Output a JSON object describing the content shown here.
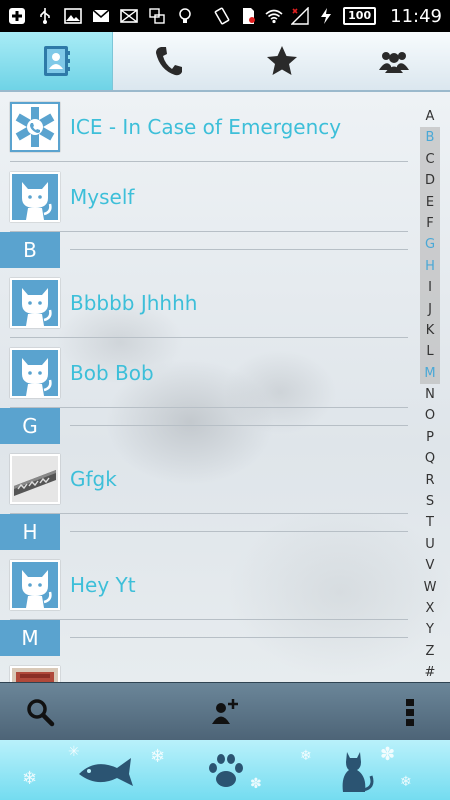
{
  "status_bar": {
    "battery": "100",
    "time": "11:49"
  },
  "tabs": [
    {
      "icon": "contacts-icon",
      "active": true
    },
    {
      "icon": "phone-icon",
      "active": false
    },
    {
      "icon": "star-icon",
      "active": false
    },
    {
      "icon": "groups-icon",
      "active": false
    }
  ],
  "contacts": {
    "ice": {
      "name": "ICE - In Case of Emergency"
    },
    "myself": {
      "name": "Myself"
    },
    "section_b": "B",
    "bbbbb": {
      "name": "Bbbbb Jhhhh"
    },
    "bob": {
      "name": "Bob Bob"
    },
    "section_g": "G",
    "gfgk": {
      "name": "Gfgk"
    },
    "section_h": "H",
    "hey": {
      "name": "Hey Yt"
    },
    "section_m": "M"
  },
  "alphabet_index": [
    "A",
    "B",
    "C",
    "D",
    "E",
    "F",
    "G",
    "H",
    "I",
    "J",
    "K",
    "L",
    "M",
    "N",
    "O",
    "P",
    "Q",
    "R",
    "S",
    "T",
    "U",
    "V",
    "W",
    "X",
    "Y",
    "Z",
    "#"
  ],
  "toolbar": {
    "search": "search-icon",
    "add_contact": "add-contact-icon",
    "menu": "overflow-menu-icon"
  },
  "banner": {
    "left": "fish-icon",
    "center": "paw-icon",
    "right": "cat-icon"
  }
}
